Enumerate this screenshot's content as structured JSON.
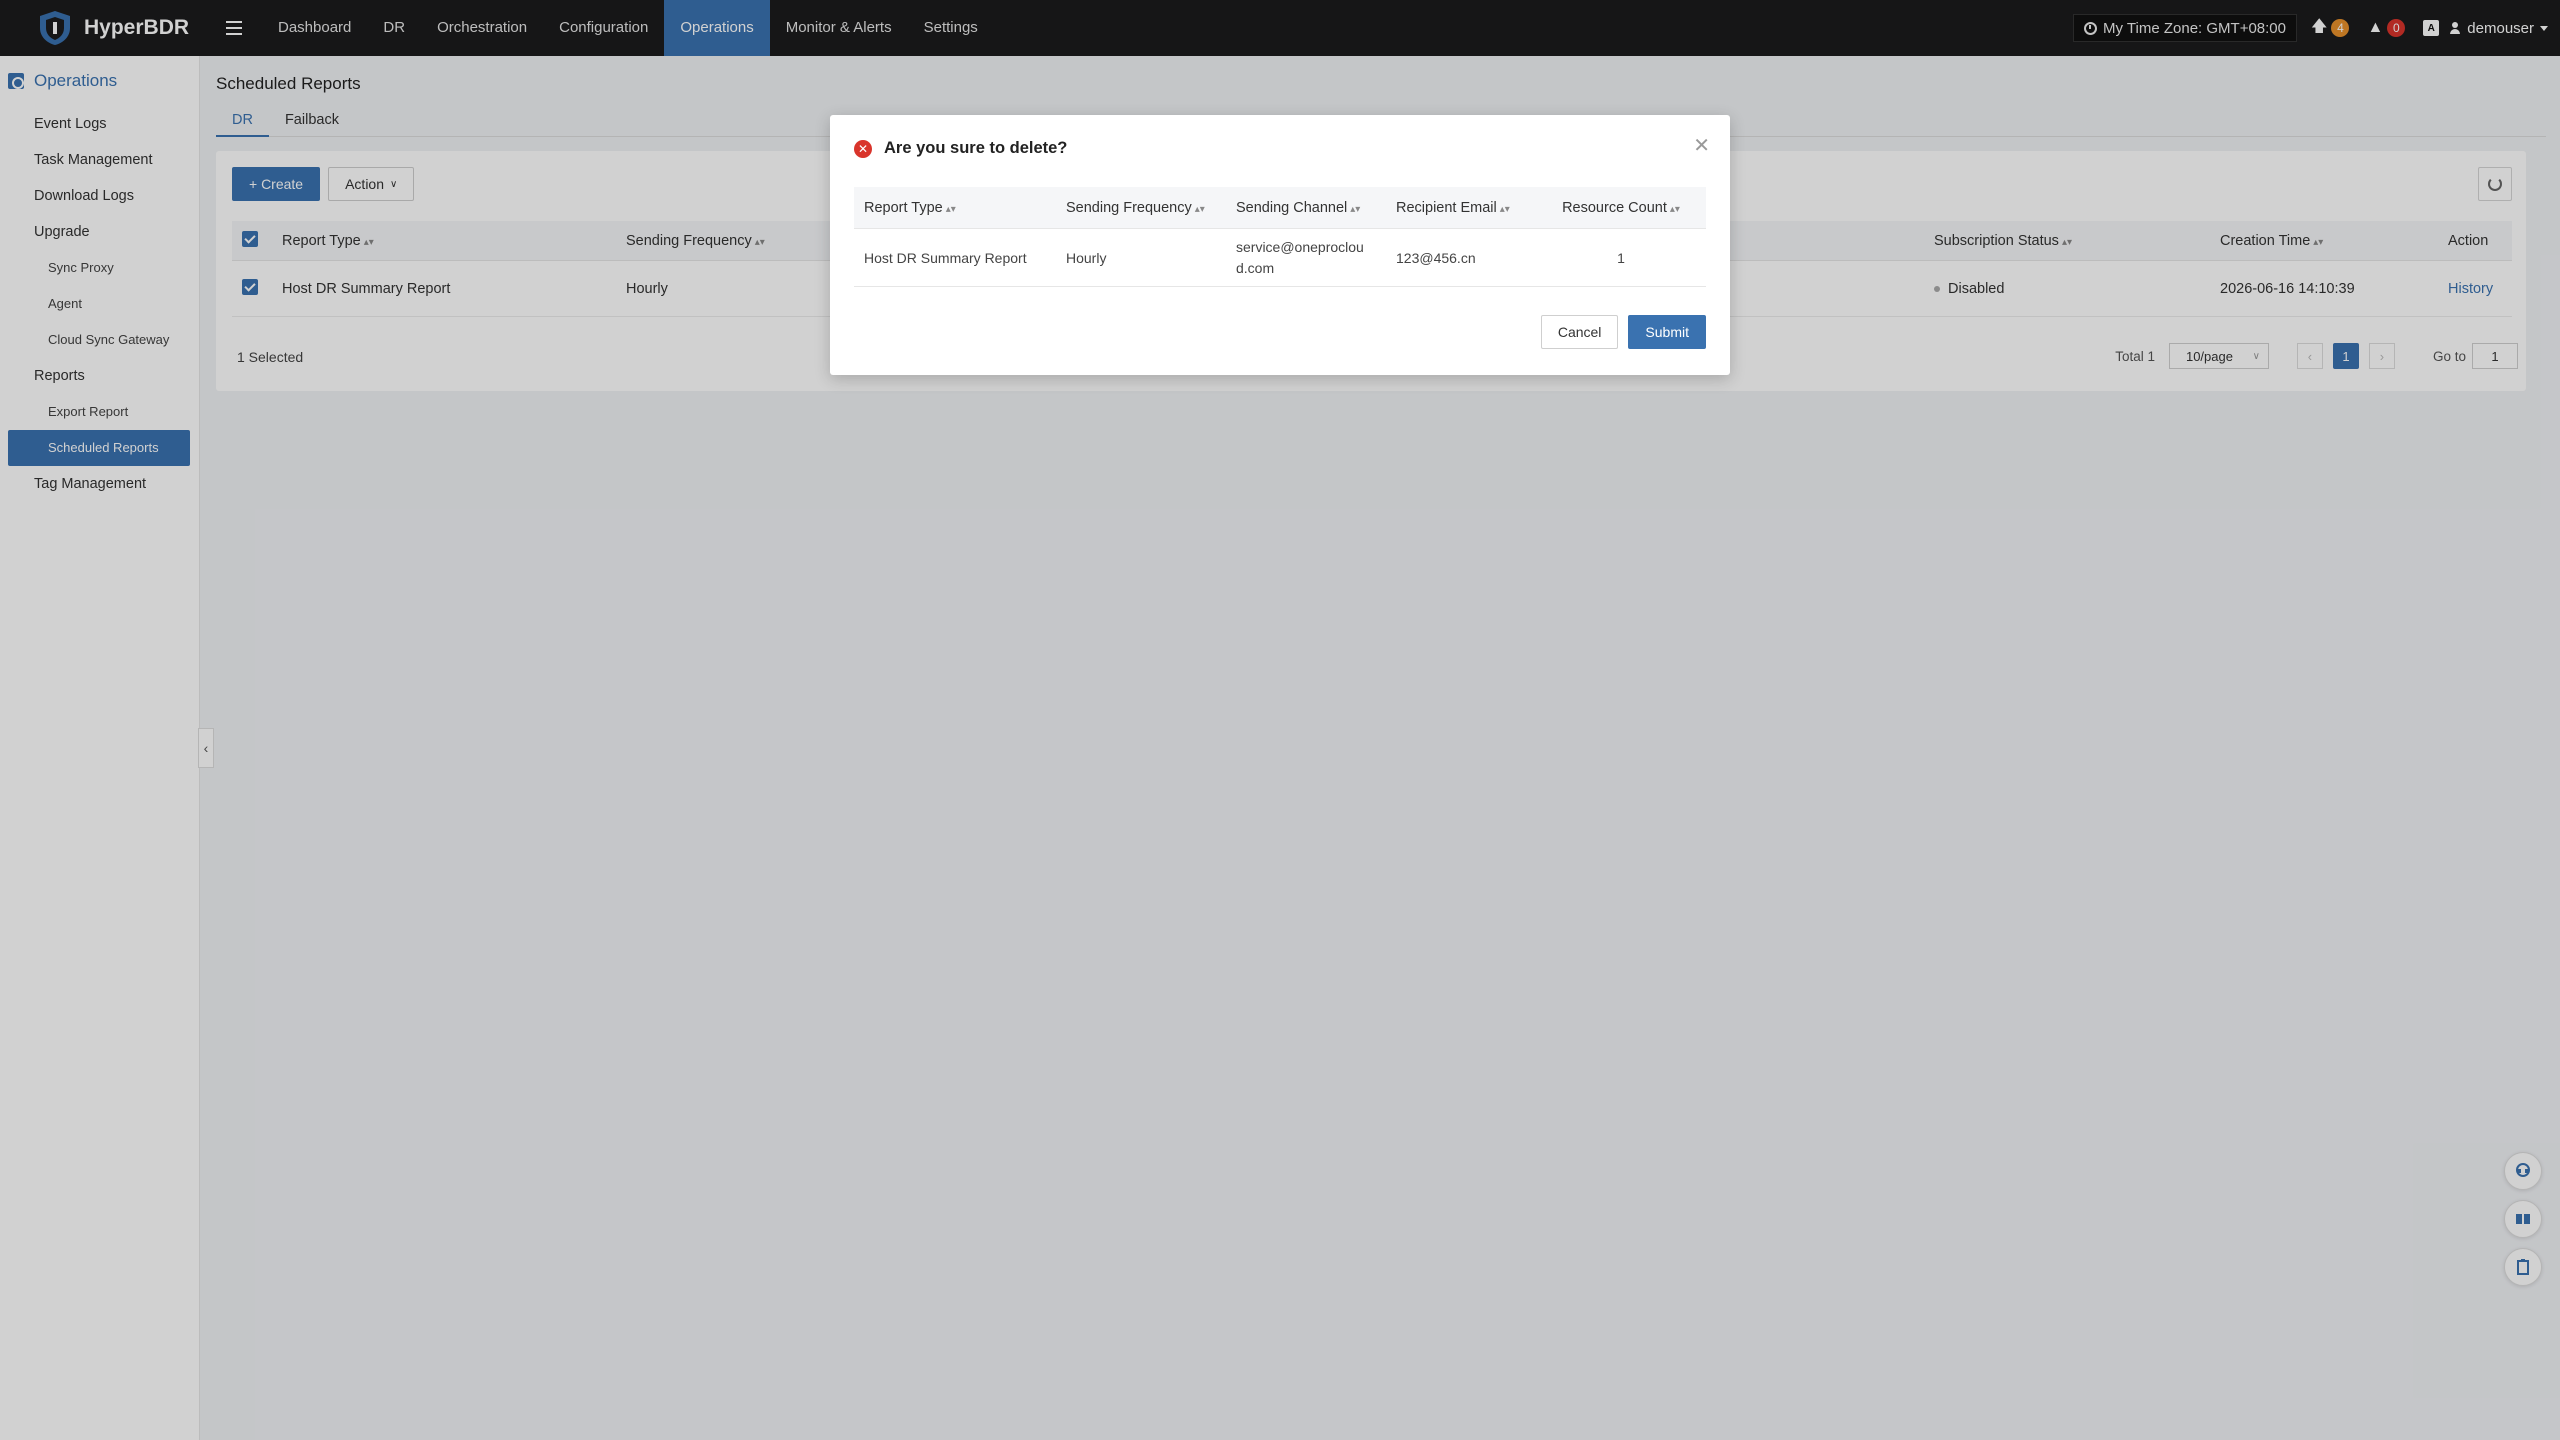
{
  "app": {
    "name": "HyperBDR"
  },
  "nav": {
    "items": [
      {
        "label": "Dashboard"
      },
      {
        "label": "DR"
      },
      {
        "label": "Orchestration"
      },
      {
        "label": "Configuration"
      },
      {
        "label": "Operations",
        "active": true
      },
      {
        "label": "Monitor & Alerts"
      },
      {
        "label": "Settings"
      }
    ]
  },
  "topright": {
    "timezone": "My Time Zone: GMT+08:00",
    "upgrade_count": "4",
    "alert_count": "0",
    "user": "demouser"
  },
  "sidebar": {
    "header": "Operations",
    "items": [
      {
        "label": "Event Logs",
        "level": 1
      },
      {
        "label": "Task Management",
        "level": 1
      },
      {
        "label": "Download Logs",
        "level": 1
      },
      {
        "label": "Upgrade",
        "level": 1
      },
      {
        "label": "Sync Proxy",
        "level": 2
      },
      {
        "label": "Agent",
        "level": 2
      },
      {
        "label": "Cloud Sync Gateway",
        "level": 2
      },
      {
        "label": "Reports",
        "level": 1
      },
      {
        "label": "Export Report",
        "level": 2
      },
      {
        "label": "Scheduled Reports",
        "level": 2,
        "active": true
      },
      {
        "label": "Tag Management",
        "level": 1
      }
    ]
  },
  "page": {
    "title": "Scheduled Reports",
    "tabs": [
      {
        "label": "DR",
        "active": true
      },
      {
        "label": "Failback"
      }
    ]
  },
  "toolbar": {
    "create_label": "+ Create",
    "action_label": "Action"
  },
  "table": {
    "headers": {
      "report_type": "Report Type",
      "sending_frequency": "Sending Frequency",
      "subscription_status": "Subscription Status",
      "creation_time": "Creation Time",
      "action": "Action"
    },
    "rows": [
      {
        "report_type": "Host DR Summary Report",
        "sending_frequency": "Hourly",
        "subscription_status": "Disabled",
        "creation_time": "2026-06-16 14:10:39",
        "action": "History"
      }
    ]
  },
  "footer": {
    "selected": "1 Selected",
    "total": "Total 1",
    "page_size": "10/page",
    "current_page": "1",
    "goto_label": "Go to",
    "goto_value": "1"
  },
  "modal": {
    "title": "Are you sure to delete?",
    "headers": {
      "report_type": "Report Type",
      "sending_frequency": "Sending Frequency",
      "sending_channel": "Sending Channel",
      "recipient_email": "Recipient Email",
      "resource_count": "Resource Count"
    },
    "row": {
      "report_type": "Host DR Summary Report",
      "sending_frequency": "Hourly",
      "sending_channel": "service@oneproclou d.com",
      "recipient_email": "123@456.cn",
      "resource_count": "1"
    },
    "cancel_label": "Cancel",
    "submit_label": "Submit"
  },
  "colors": {
    "primary": "#3a72b0",
    "topbar": "#1b1b1d",
    "danger": "#d9342b",
    "warning": "#e8912b"
  }
}
